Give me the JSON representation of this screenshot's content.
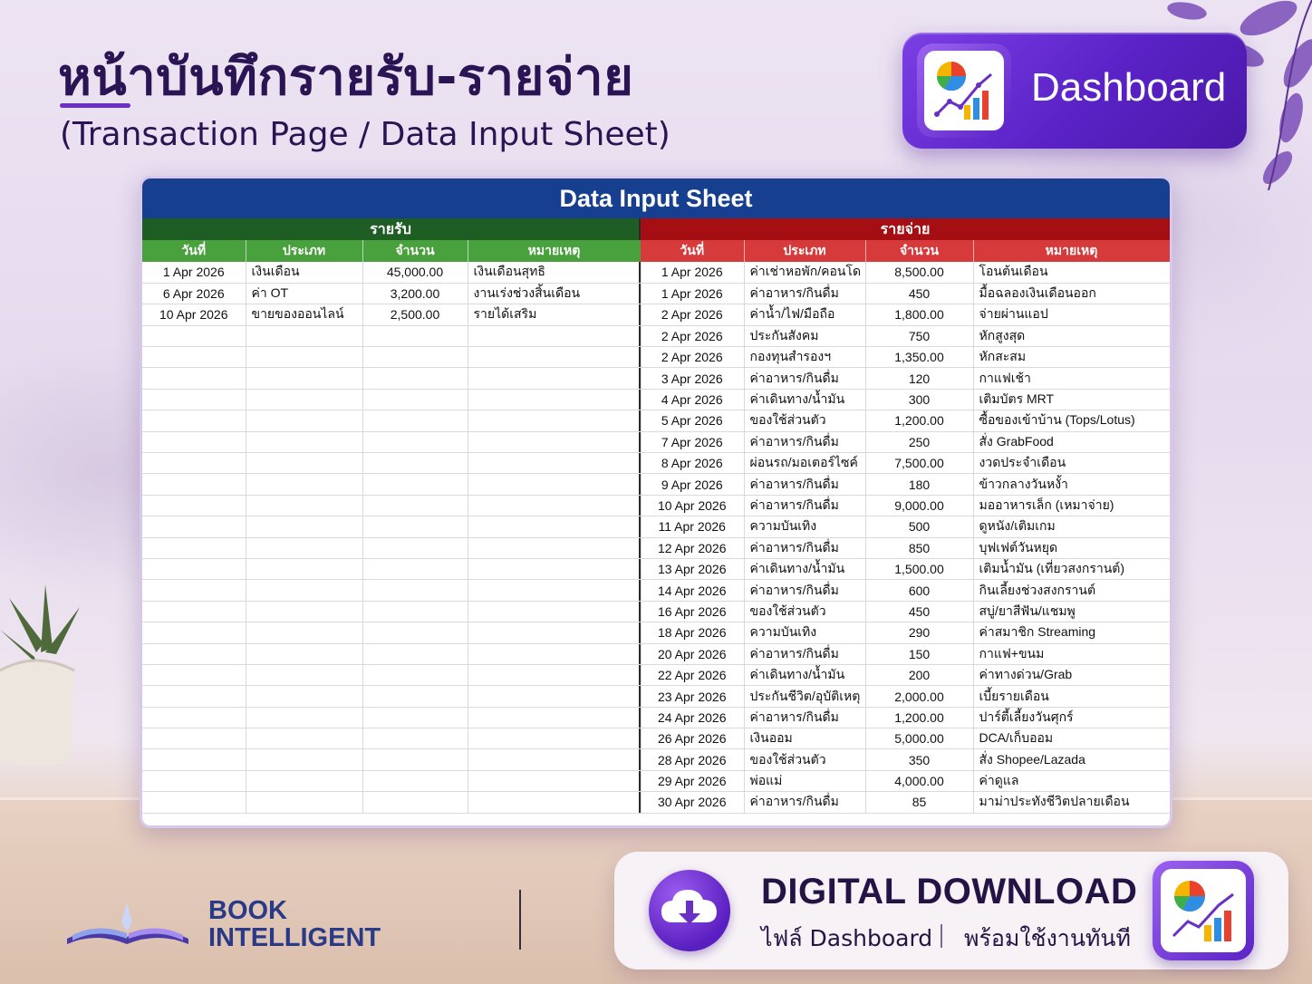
{
  "header": {
    "title": "หน้าบันทึกรายรับ-รายจ่าย",
    "subtitle": "(Transaction Page / Data Input Sheet)",
    "dashboard_label": "Dashboard"
  },
  "sheet": {
    "title": "Data Input Sheet",
    "income": {
      "section_label": "รายรับ",
      "columns": [
        "วันที่",
        "ประเภท",
        "จำนวน",
        "หมายเหตุ"
      ],
      "rows": [
        [
          "1 Apr 2026",
          "เงินเดือน",
          "45,000.00",
          "เงินเดือนสุทธิ"
        ],
        [
          "6 Apr 2026",
          "ค่า OT",
          "3,200.00",
          "งานเร่งช่วงสิ้นเดือน"
        ],
        [
          "10 Apr 2026",
          "ขายของออนไลน์",
          "2,500.00",
          "รายได้เสริม"
        ]
      ]
    },
    "expense": {
      "section_label": "รายจ่าย",
      "columns": [
        "วันที่",
        "ประเภท",
        "จำนวน",
        "หมายเหตุ"
      ],
      "rows": [
        [
          "1 Apr 2026",
          "ค่าเช่าหอพัก/คอนโด",
          "8,500.00",
          "โอนต้นเดือน"
        ],
        [
          "1 Apr 2026",
          "ค่าอาหาร/กินดื่ม",
          "450",
          "มื้อฉลองเงินเดือนออก"
        ],
        [
          "2 Apr 2026",
          "ค่าน้ำ/ไฟ/มือถือ",
          "1,800.00",
          "จ่ายผ่านแอป"
        ],
        [
          "2 Apr 2026",
          "ประกันสังคม",
          "750",
          "หักสูงสุด"
        ],
        [
          "2 Apr 2026",
          "กองทุนสำรองฯ",
          "1,350.00",
          "หักสะสม"
        ],
        [
          "3 Apr 2026",
          "ค่าอาหาร/กินดื่ม",
          "120",
          "กาแฟเช้า"
        ],
        [
          "4 Apr 2026",
          "ค่าเดินทาง/น้ำมัน",
          "300",
          "เติมบัตร MRT"
        ],
        [
          "5 Apr 2026",
          "ของใช้ส่วนตัว",
          "1,200.00",
          "ซื้อของเข้าบ้าน (Tops/Lotus)"
        ],
        [
          "7 Apr 2026",
          "ค่าอาหาร/กินดื่ม",
          "250",
          "สั่ง GrabFood"
        ],
        [
          "8 Apr 2026",
          "ผ่อนรถ/มอเตอร์ไซค์",
          "7,500.00",
          "งวดประจำเดือน"
        ],
        [
          "9 Apr 2026",
          "ค่าอาหาร/กินดื่ม",
          "180",
          "ข้าวกลางวันหงั้า"
        ],
        [
          "10 Apr 2026",
          "ค่าอาหาร/กินดื่ม",
          "9,000.00",
          "มออาหารเล็ก (เหมาจ่าย)"
        ],
        [
          "11 Apr 2026",
          "ความบันเทิง",
          "500",
          "ดูหนัง/เติมเกม"
        ],
        [
          "12 Apr 2026",
          "ค่าอาหาร/กินดื่ม",
          "850",
          "บุฟเฟต์วันหยุด"
        ],
        [
          "13 Apr 2026",
          "ค่าเดินทาง/น้ำมัน",
          "1,500.00",
          "เติมน้ำมัน (เที่ยวสงกรานต์)"
        ],
        [
          "14 Apr 2026",
          "ค่าอาหาร/กินดื่ม",
          "600",
          "กินเลี้ยงช่วงสงกรานต์"
        ],
        [
          "16 Apr 2026",
          "ของใช้ส่วนตัว",
          "450",
          "สบู่/ยาสีฟัน/แชมพู"
        ],
        [
          "18 Apr 2026",
          "ความบันเทิง",
          "290",
          "ค่าสมาชิก Streaming"
        ],
        [
          "20 Apr 2026",
          "ค่าอาหาร/กินดื่ม",
          "150",
          "กาแฟ+ขนม"
        ],
        [
          "22 Apr 2026",
          "ค่าเดินทาง/น้ำมัน",
          "200",
          "ค่าทางด่วน/Grab"
        ],
        [
          "23 Apr 2026",
          "ประกันชีวิต/อุบัติเหตุ",
          "2,000.00",
          "เบี้ยรายเดือน"
        ],
        [
          "24 Apr 2026",
          "ค่าอาหาร/กินดื่ม",
          "1,200.00",
          "ปาร์ตี้เลี้ยงวันศุกร์"
        ],
        [
          "26 Apr 2026",
          "เงินออม",
          "5,000.00",
          "DCA/เก็บออม"
        ],
        [
          "28 Apr 2026",
          "ของใช้ส่วนตัว",
          "350",
          "สั่ง Shopee/Lazada"
        ],
        [
          "29 Apr 2026",
          "พ่อแม่",
          "4,000.00",
          "ค่าดูแล"
        ],
        [
          "30 Apr 2026",
          "ค่าอาหาร/กินดื่ม",
          "85",
          "มาม่าประทังชีวิตปลายเดือน"
        ]
      ]
    },
    "total_rows": 26
  },
  "footer": {
    "brand_line1": "BOOK",
    "brand_line2": "INTELLIGENT",
    "download_title": "DIGITAL DOWNLOAD",
    "download_sub_a": "ไฟล์ Dashboard",
    "download_sub_b": "พร้อมใช้งานทันที"
  },
  "colors": {
    "title_bar": "#163f8f",
    "income_section": "#1e5d24",
    "income_header": "#48a13d",
    "expense_section": "#a50f13",
    "expense_header": "#d73a3a",
    "accent_purple": "#5a22c6"
  },
  "icons": {
    "dashboard": "dashboard-chart-icon",
    "download": "cloud-download-icon",
    "brand": "open-book-logo"
  }
}
